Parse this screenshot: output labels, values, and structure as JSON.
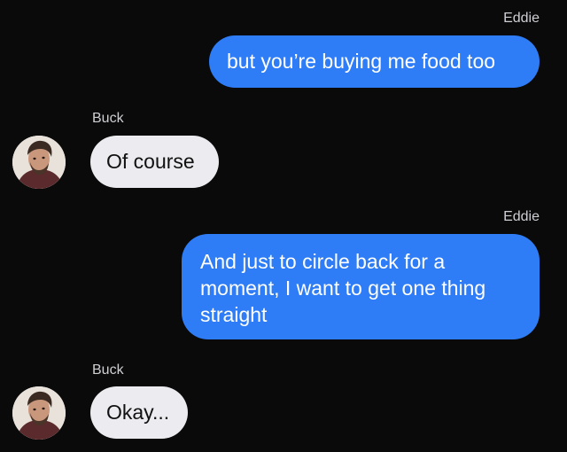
{
  "conversation": {
    "messages": [
      {
        "sender": "Eddie",
        "direction": "outgoing",
        "text": "but you’re buying me food too"
      },
      {
        "sender": "Buck",
        "direction": "incoming",
        "text": "Of course"
      },
      {
        "sender": "Eddie",
        "direction": "outgoing",
        "text": "And just to circle back for a moment, I want to get one thing straight"
      },
      {
        "sender": "Buck",
        "direction": "incoming",
        "text": "Okay..."
      }
    ]
  },
  "colors": {
    "background": "#0a0a0a",
    "outgoing_bubble": "#2e7cf6",
    "incoming_bubble": "#ececf0",
    "sender_name": "#cfcfd4"
  },
  "icons": {
    "avatar": "buck-avatar"
  }
}
